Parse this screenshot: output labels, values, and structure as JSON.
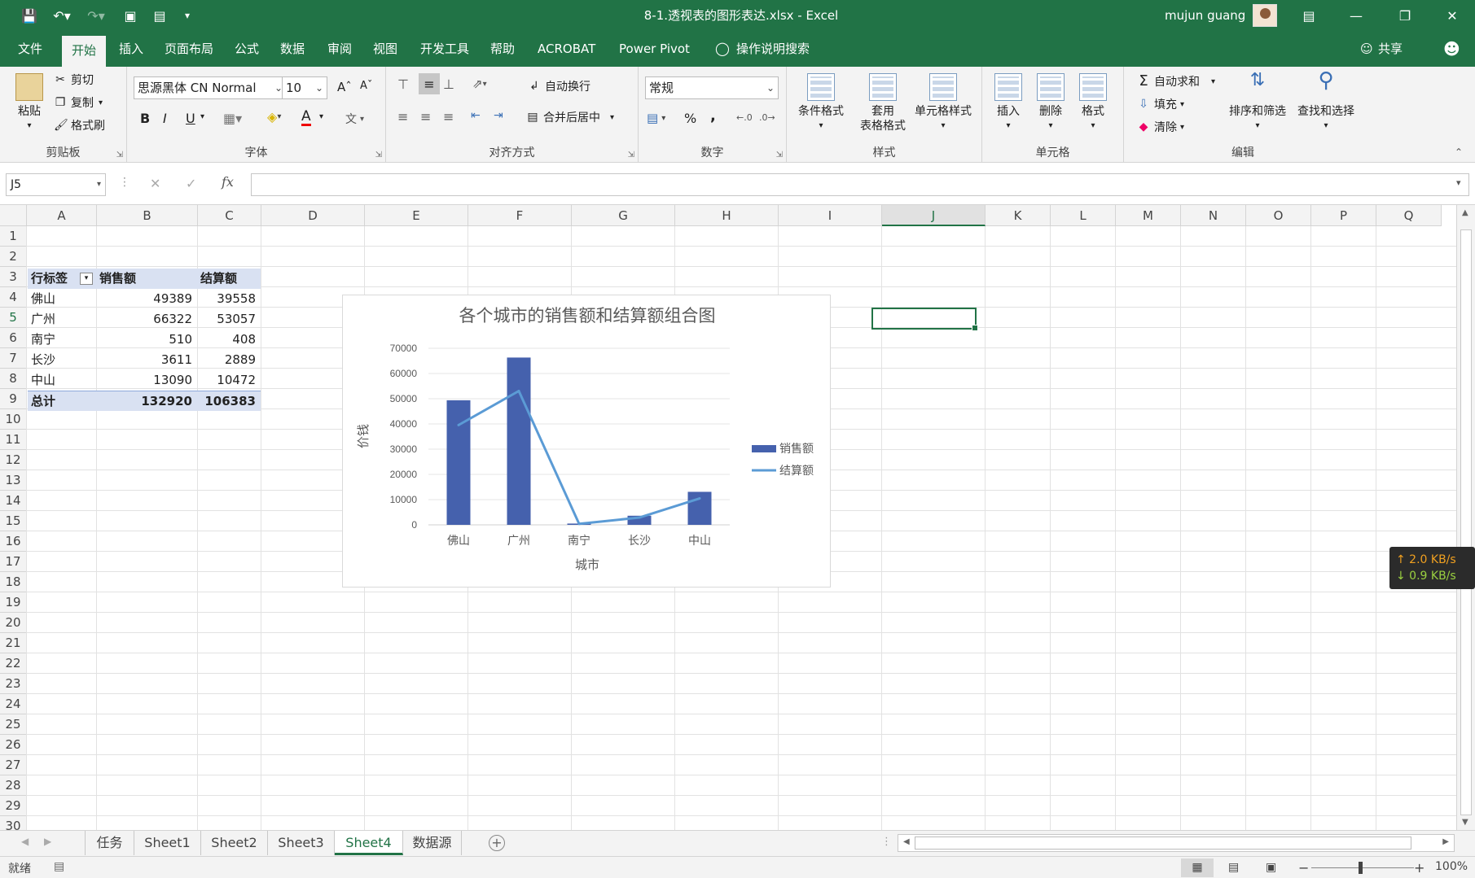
{
  "titlebar": {
    "doc_title": "8-1.透视表的图形表达.xlsx  -  Excel",
    "user": "mujun guang"
  },
  "menu": {
    "tabs": [
      "文件",
      "开始",
      "插入",
      "页面布局",
      "公式",
      "数据",
      "审阅",
      "视图",
      "开发工具",
      "帮助",
      "ACROBAT",
      "Power Pivot",
      "操作说明搜索"
    ],
    "share": "共享"
  },
  "ribbon": {
    "clipboard": {
      "label": "剪贴板",
      "paste": "粘贴",
      "cut": "剪切",
      "copy": "复制",
      "format_painter": "格式刷"
    },
    "font": {
      "label": "字体",
      "font_name": "思源黑体 CN Normal",
      "font_size": "10",
      "bold": "B",
      "italic": "I",
      "underline": "U",
      "color_a": "A",
      "wen": "文"
    },
    "alignment": {
      "label": "对齐方式",
      "wrap": "自动换行",
      "merge": "合并后居中"
    },
    "number": {
      "label": "数字",
      "format": "常规",
      "percent": "%",
      "comma": ","
    },
    "styles": {
      "label": "样式",
      "conditional": "条件格式",
      "table_line1": "套用",
      "table_line2": "表格格式",
      "cell_styles": "单元格样式"
    },
    "cells": {
      "label": "单元格",
      "insert": "插入",
      "delete": "删除",
      "format": "格式"
    },
    "editing": {
      "label": "编辑",
      "autosum": "自动求和",
      "fill": "填充",
      "clear": "清除",
      "sort": "排序和筛选",
      "find": "查找和选择"
    }
  },
  "formula_bar": {
    "name_box": "J5",
    "fx": "fx",
    "value": ""
  },
  "columns": [
    "A",
    "B",
    "C",
    "D",
    "E",
    "F",
    "G",
    "H",
    "I",
    "J",
    "K",
    "L",
    "M",
    "N",
    "O",
    "P",
    "Q"
  ],
  "rows": [
    "1",
    "2",
    "3",
    "4",
    "5",
    "6",
    "7",
    "8",
    "9",
    "10",
    "11",
    "12",
    "13",
    "14",
    "15",
    "16",
    "17",
    "18",
    "19",
    "20",
    "21",
    "22",
    "23",
    "24",
    "25",
    "26",
    "27",
    "28",
    "29",
    "30"
  ],
  "pivot": {
    "headers": [
      "行标签",
      "销售额",
      "结算额"
    ],
    "rows": [
      [
        "佛山",
        "49389",
        "39558"
      ],
      [
        "广州",
        "66322",
        "53057"
      ],
      [
        "南宁",
        "510",
        "408"
      ],
      [
        "长沙",
        "3611",
        "2889"
      ],
      [
        "中山",
        "13090",
        "10472"
      ]
    ],
    "total": [
      "总计",
      "132920",
      "106383"
    ]
  },
  "chart_data": {
    "type": "bar",
    "title": "各个城市的销售额和结算额组合图",
    "xlabel": "城市",
    "ylabel": "价钱",
    "categories": [
      "佛山",
      "广州",
      "南宁",
      "长沙",
      "中山"
    ],
    "ylim": [
      0,
      70000
    ],
    "yticks": [
      "70000",
      "60000",
      "50000",
      "40000",
      "30000",
      "20000",
      "10000",
      "0"
    ],
    "series": [
      {
        "name": "销售额",
        "kind": "bar",
        "color": "#4561ad",
        "values": [
          49389,
          66322,
          510,
          3611,
          13090
        ]
      },
      {
        "name": "结算额",
        "kind": "line",
        "color": "#5b9bd5",
        "values": [
          39558,
          53057,
          408,
          2889,
          10472
        ]
      }
    ],
    "legend_position": "right",
    "grid": true
  },
  "sheets": {
    "tabs": [
      "任务",
      "Sheet1",
      "Sheet2",
      "Sheet3",
      "Sheet4",
      "数据源"
    ],
    "active": "Sheet4"
  },
  "status": {
    "ready": "就绪",
    "zoom": "100%"
  },
  "network": {
    "up": "↑ 2.0 KB/s",
    "down": "↓ 0.9 KB/s"
  }
}
